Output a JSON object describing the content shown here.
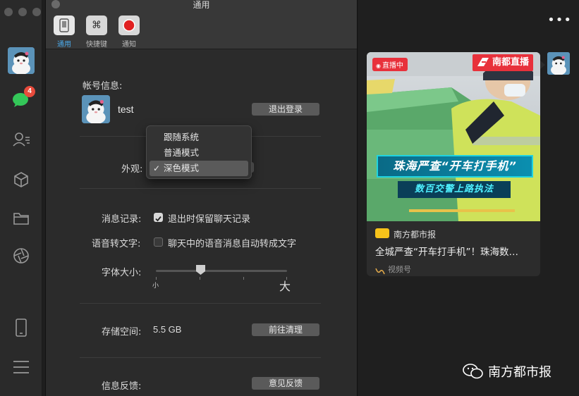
{
  "window": {
    "title": "通用"
  },
  "tabs": [
    {
      "label": "通用",
      "active": true
    },
    {
      "label": "快捷键",
      "active": false
    },
    {
      "label": "通知",
      "active": false
    }
  ],
  "sidebar": {
    "chat_badge": "4",
    "icons": [
      "chat-icon",
      "contacts-icon",
      "box-icon",
      "folder-icon",
      "moments-icon",
      "phone-icon",
      "menu-icon"
    ]
  },
  "account": {
    "section_label": "帐号信息:",
    "name": "test",
    "logout_button": "退出登录"
  },
  "appearance": {
    "label": "外观:",
    "options": [
      "跟随系统",
      "普通模式",
      "深色模式"
    ],
    "selected": "深色模式",
    "check": "✓"
  },
  "chat_history": {
    "label": "消息记录:",
    "checkbox_text": "退出时保留聊天记录",
    "checked": true
  },
  "voice_to_text": {
    "label": "语音转文字:",
    "checkbox_text": "聊天中的语音消息自动转成文字",
    "checked": false
  },
  "font_size": {
    "label": "字体大小:",
    "small_label": "小",
    "large_label": "大",
    "level": 0.33
  },
  "storage": {
    "label": "存储空间:",
    "value": "5.5 GB",
    "button": "前往清理"
  },
  "feedback": {
    "label": "信息反馈:",
    "button": "意见反馈"
  },
  "feed": {
    "more": "•••",
    "live_badge": "直播中",
    "channel_badge": "南都直播",
    "headline_line1": "珠海严查“开车打手机”",
    "headline_line2": "数百交警上路执法",
    "source_name": "南方都市报",
    "title": "全城严查“开车打手机”！珠海数…",
    "channel_label": "视频号",
    "watermark": "南方都市报",
    "colors": {
      "live_red": "#e8313b",
      "headline_cyan": "#4ef1ff",
      "accent_blue": "#4aa8e8"
    }
  }
}
